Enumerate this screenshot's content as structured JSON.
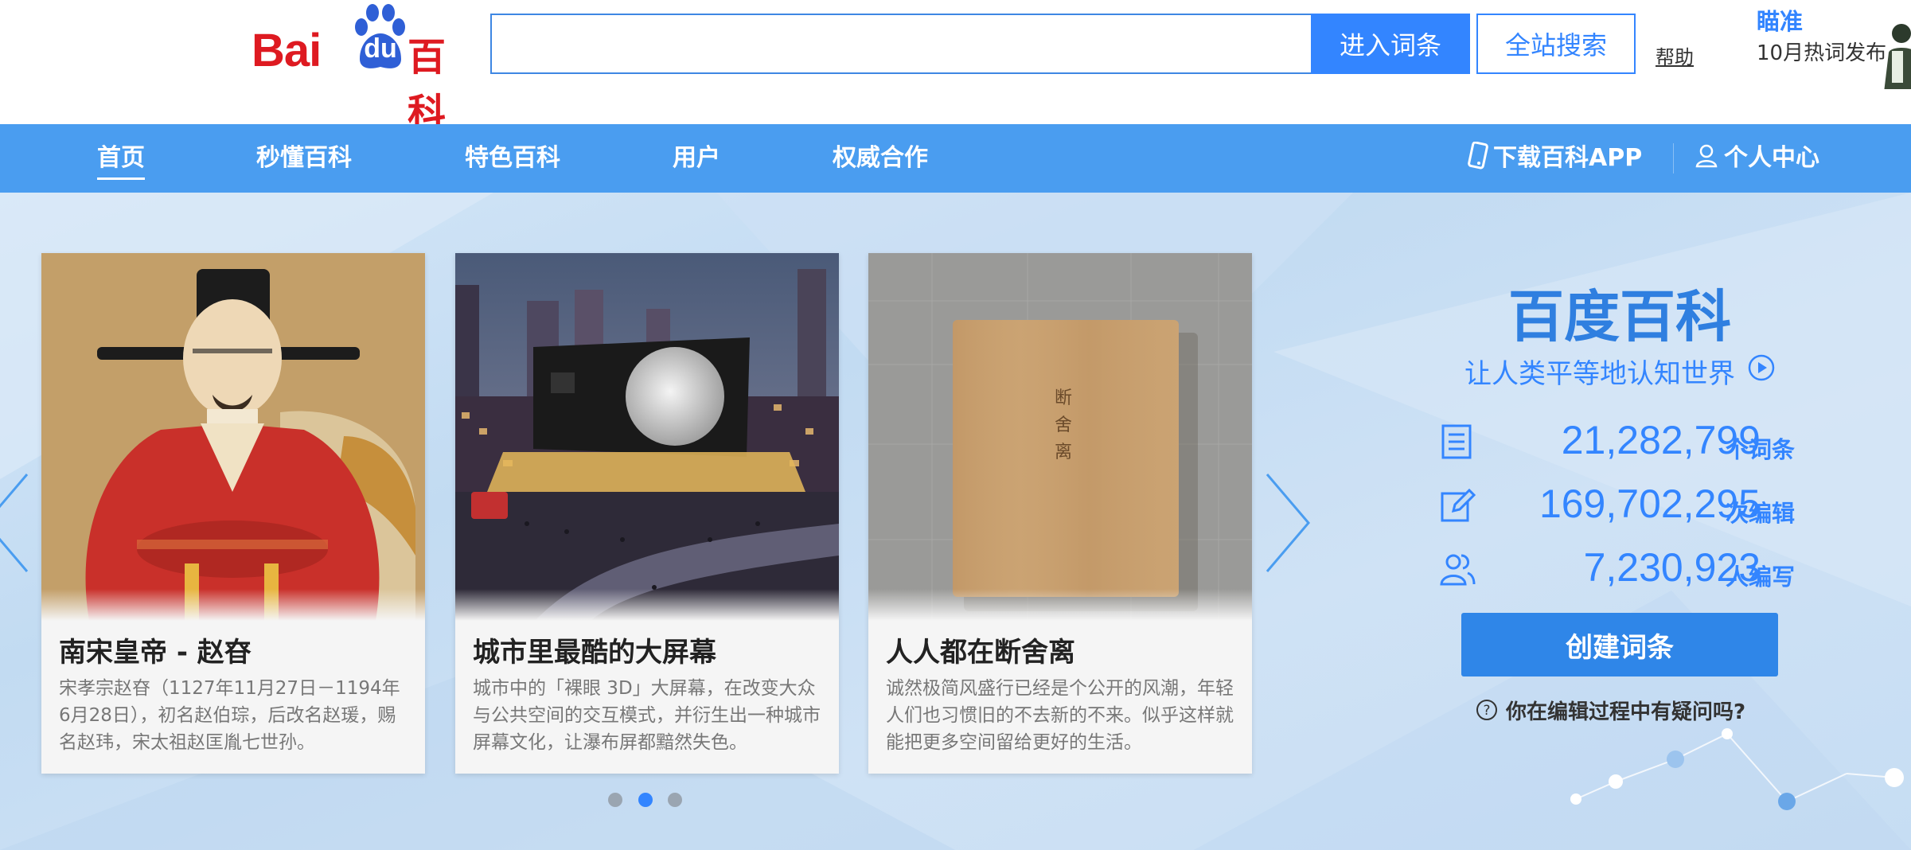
{
  "header": {
    "logo": {
      "bai": "Bai",
      "du": "du",
      "baike": "百科"
    },
    "search": {
      "placeholder": "",
      "value": ""
    },
    "enter_button": "进入词条",
    "site_search_button": "全站搜索",
    "help_link": "帮助",
    "promo": {
      "title": "瞄准",
      "subtitle": "10月热词发布"
    }
  },
  "nav": {
    "items": [
      {
        "label": "首页",
        "active": true
      },
      {
        "label": "秒懂百科"
      },
      {
        "label": "特色百科"
      },
      {
        "label": "用户"
      },
      {
        "label": "权威合作"
      }
    ],
    "download_app": "下载百科APP",
    "user_center": "个人中心"
  },
  "carousel": {
    "cards": [
      {
        "title": "南宋皇帝 - 赵昚",
        "desc": "宋孝宗赵昚（1127年11月27日－1194年6月28日），初名赵伯琮，后改名赵瑗，赐名赵玮，宋太祖赵匡胤七世孙。",
        "image": "portrait-painting"
      },
      {
        "title": "城市里最酷的大屏幕",
        "desc": "城市中的「裸眼 3D」大屏幕，在改变大众与公共空间的交互模式，并衍生出一种城市屏幕文化，让瀑布屏都黯然失色。",
        "image": "city-night-screen"
      },
      {
        "title": "人人都在断舍离",
        "desc": "诚然极简风盛行已经是个公开的风潮，年轻人们也习惯旧的不去新的不来。似乎这样就能把更多空间留给更好的生活。",
        "image": "wooden-box"
      }
    ],
    "dots": 3,
    "active_dot": 2,
    "box_text": [
      "断",
      "舍",
      "离"
    ]
  },
  "stats": {
    "title": "百度百科",
    "slogan": "让人类平等地认知世界",
    "rows": [
      {
        "value": "21,282,799",
        "unit": "个词条",
        "icon": "document-list-icon"
      },
      {
        "value": "169,702,295",
        "unit": "次编辑",
        "icon": "edit-icon"
      },
      {
        "value": "7,230,923",
        "unit": "人编写",
        "icon": "users-icon"
      }
    ],
    "create_button": "创建词条",
    "faq": "你在编辑过程中有疑问吗?"
  },
  "colors": {
    "brand_red": "#de1a21",
    "accent_blue": "#3385ff",
    "nav_blue": "#4a9df0"
  }
}
